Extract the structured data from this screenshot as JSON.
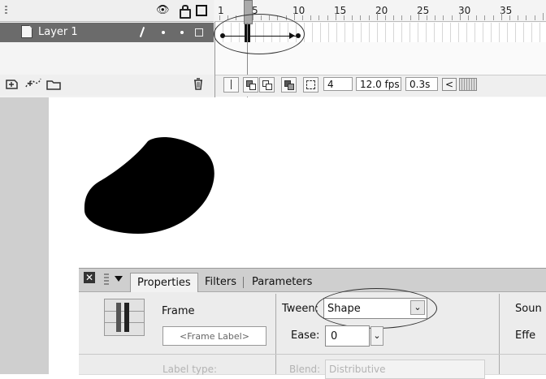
{
  "timeline": {
    "layer_name": "Layer 1",
    "ruler_numbers": [
      "1",
      "5",
      "10",
      "15",
      "20",
      "25",
      "30",
      "35"
    ],
    "current_frame": "4",
    "frame_rate": "12.0 fps",
    "elapsed_time": "0.3s"
  },
  "panel": {
    "tabs": [
      "Properties",
      "Filters",
      "Parameters"
    ],
    "active_tab": "Properties",
    "frame_label_title": "Frame",
    "frame_label_placeholder": "<Frame Label>",
    "tween_label": "Tween:",
    "tween_value": "Shape",
    "ease_label": "Ease:",
    "ease_value": "0",
    "sound_label_partial": "Soun",
    "effect_label_partial": "Effe",
    "label_type_partial": "Label type:",
    "blend_label_partial": "Blend:",
    "blend_value_partial": "Distributive"
  },
  "colors": {
    "layer_row_bg": "#6b6b6b",
    "shape_fill": "#000000",
    "stage_gray": "#cfcfcf"
  }
}
